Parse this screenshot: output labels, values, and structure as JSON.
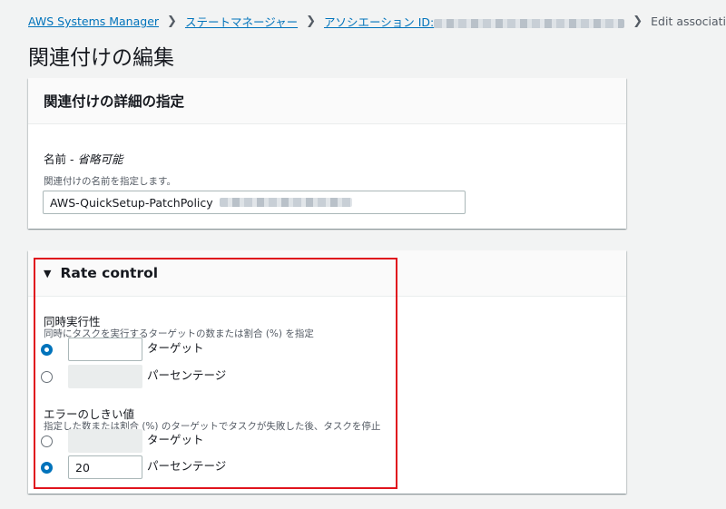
{
  "breadcrumb": {
    "items": [
      "AWS Systems Manager",
      "ステートマネージャー",
      "アソシエーション ID:"
    ],
    "current": "Edit association"
  },
  "page_title": "関連付けの編集",
  "details_panel": {
    "header": "関連付けの詳細の指定",
    "name_label": "名前 - ",
    "name_optional": "省略可能",
    "name_description": "関連付けの名前を指定します。",
    "name_value": "AWS-QuickSetup-PatchPolicy"
  },
  "rate_control": {
    "header": "Rate control",
    "concurrency": {
      "label": "同時実行性",
      "description": "同時にタスクを実行するターゲットの数または割合 (%) を指定",
      "options": [
        {
          "unit": "ターゲット",
          "value": "",
          "selected": true
        },
        {
          "unit": "パーセンテージ",
          "value": "",
          "selected": false
        }
      ]
    },
    "error_threshold": {
      "label": "エラーのしきい値",
      "description": "指定した数または割合 (%) のターゲットでタスクが失敗した後、タスクを停止",
      "options": [
        {
          "unit": "ターゲット",
          "value": "",
          "selected": false
        },
        {
          "unit": "パーセンテージ",
          "value": "20",
          "selected": true
        }
      ]
    }
  },
  "colors": {
    "link": "#0073bb",
    "highlight_border": "#e0141e",
    "radio_selected": "#0073bb"
  }
}
